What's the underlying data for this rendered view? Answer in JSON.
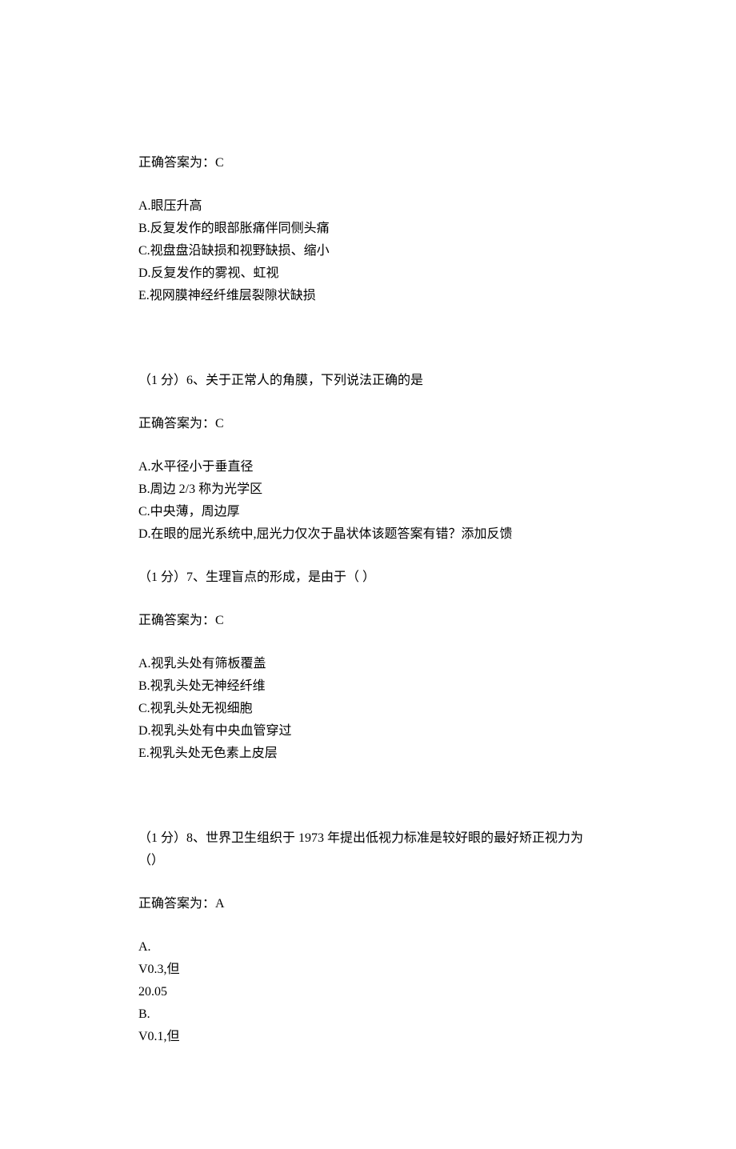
{
  "q5": {
    "answer_line": "正确答案为：C",
    "options": [
      "A.眼压升高",
      "B.反复发作的眼部胀痛伴同侧头痛",
      "C.视盘盘沿缺损和视野缺损、缩小",
      "D.反复发作的雾视、虹视",
      "E.视网膜神经纤维层裂隙状缺损"
    ]
  },
  "q6": {
    "question": "（1 分）6、关于正常人的角膜，下列说法正确的是",
    "answer_line": "正确答案为：C",
    "options": [
      "A.水平径小于垂直径",
      "B.周边 2/3 称为光学区",
      "C.中央薄，周边厚",
      "D.在眼的屈光系统中,屈光力仅次于晶状体该题答案有错？添加反馈"
    ]
  },
  "q7": {
    "question": "（1 分）7、生理盲点的形成，是由于（   ）",
    "answer_line": "正确答案为：C",
    "options": [
      "A.视乳头处有筛板覆盖",
      "B.视乳头处无神经纤维",
      "C.视乳头处无视细胞",
      "D.视乳头处有中央血管穿过",
      "E.视乳头处无色素上皮层"
    ]
  },
  "q8": {
    "question": "（1 分）8、世界卫生组织于 1973 年提出低视力标准是较好眼的最好矫正视力为（）",
    "answer_line": "正确答案为：A",
    "options": [
      "A.",
      "V0.3,但",
      "20.05",
      "B.",
      "V0.1,但"
    ]
  }
}
